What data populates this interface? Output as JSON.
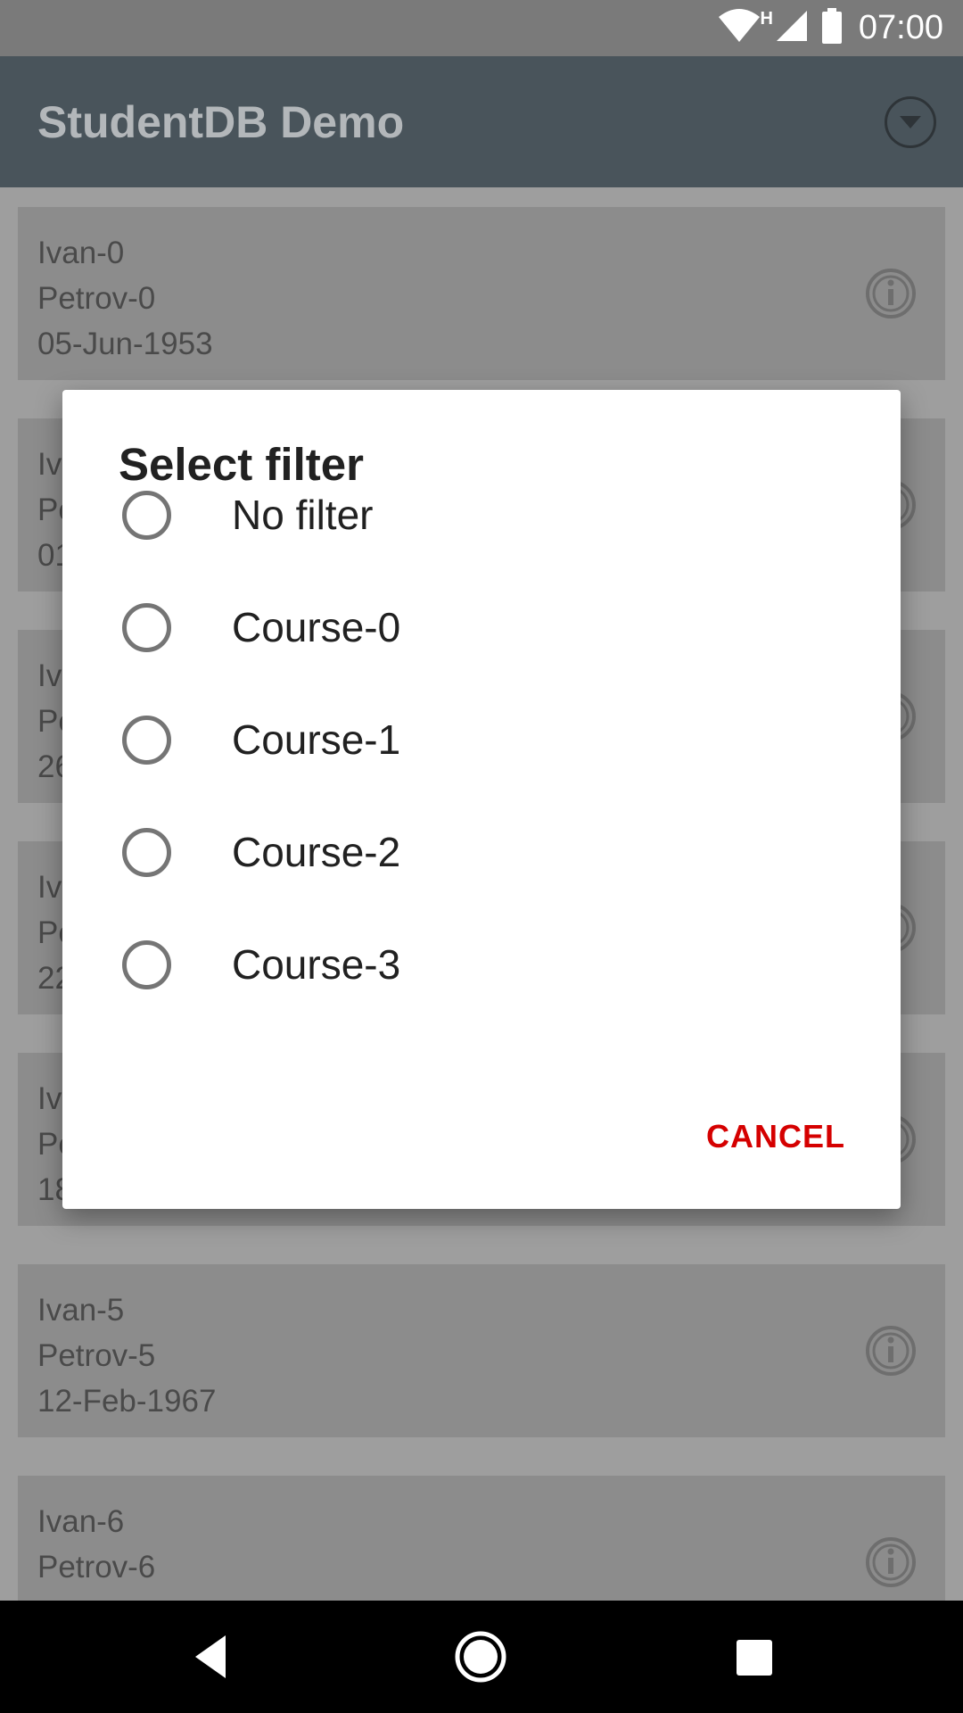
{
  "status_bar": {
    "time": "07:00",
    "network_type": "H",
    "icons": [
      "wifi-icon",
      "cell-signal-icon",
      "battery-icon"
    ]
  },
  "app_bar": {
    "title": "StudentDB Demo",
    "filter_icon": "dropdown-circle-icon"
  },
  "students": [
    {
      "first": "Ivan-0",
      "last": "Petrov-0",
      "date": "05-Jun-1953"
    },
    {
      "first": "Iv",
      "last": "Pe",
      "date": "01"
    },
    {
      "first": "Iv",
      "last": "Pe",
      "date": "26"
    },
    {
      "first": "Iv",
      "last": "Pe",
      "date": "22"
    },
    {
      "first": "Iv",
      "last": "Pe",
      "date": "18"
    },
    {
      "first": "Ivan-5",
      "last": "Petrov-5",
      "date": "12-Feb-1967"
    },
    {
      "first": "Ivan-6",
      "last": "Petrov-6",
      "date": ""
    }
  ],
  "dialog": {
    "title": "Select filter",
    "options": [
      "No filter",
      "Course-0",
      "Course-1",
      "Course-2",
      "Course-3"
    ],
    "cancel_label": "CANCEL"
  },
  "nav_bar": {
    "icons": [
      "back-icon",
      "home-icon",
      "recents-icon"
    ]
  },
  "colors": {
    "app_bar": "#49545b",
    "accent": "#d50000",
    "card": "#8c8c8c"
  }
}
